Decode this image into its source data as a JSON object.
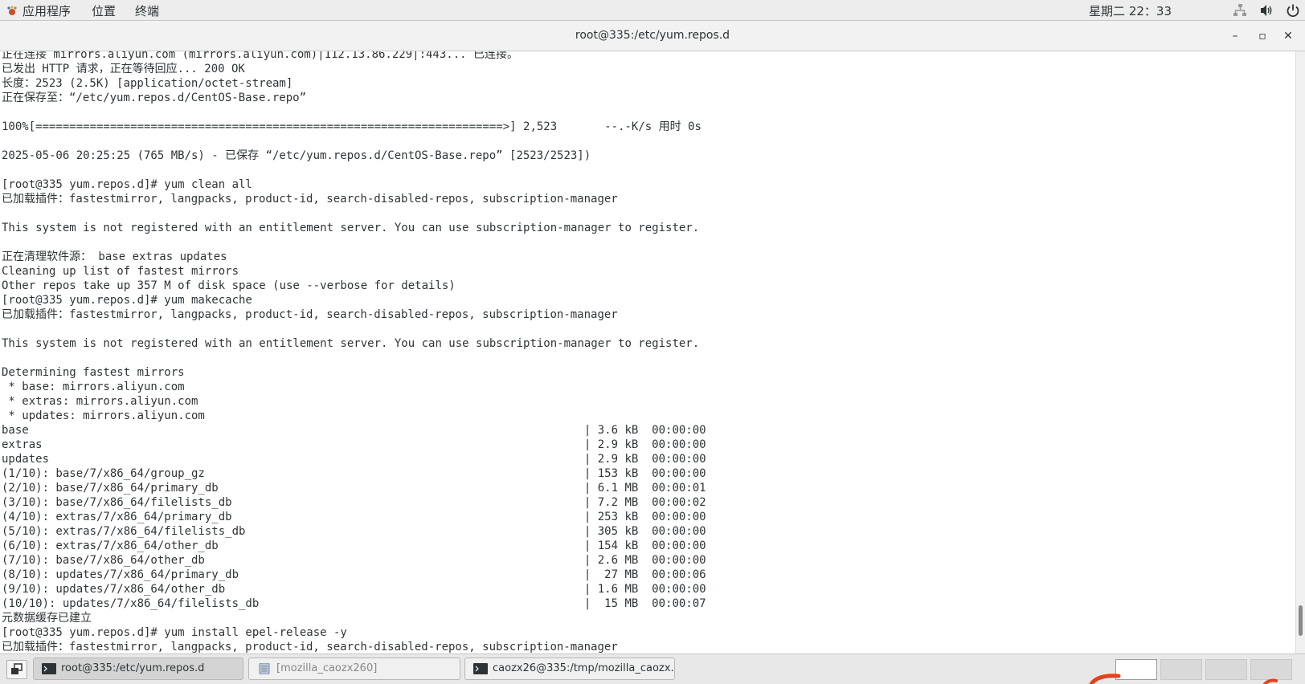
{
  "topbar": {
    "menu_app": "应用程序",
    "menu_places": "位置",
    "menu_terminal": "终端",
    "clock": "星期二 22：33",
    "icons": [
      "network-icon",
      "volume-icon",
      "power-icon"
    ]
  },
  "window": {
    "title": "root@335:/etc/yum.repos.d",
    "controls": {
      "minimize": "–",
      "maximize": "▫",
      "close": "✕"
    }
  },
  "terminal": {
    "lines": [
      "正在连接 mirrors.aliyun.com (mirrors.aliyun.com)|112.13.86.229|:443... 已连接。",
      "已发出 HTTP 请求，正在等待回应... 200 OK",
      "长度：2523 (2.5K) [application/octet-stream]",
      "正在保存至：“/etc/yum.repos.d/CentOS-Base.repo”",
      "",
      "100%[=====================================================================>] 2,523       --.-K/s 用时 0s",
      "",
      "2025-05-06 20:25:25 (765 MB/s) - 已保存 “/etc/yum.repos.d/CentOS-Base.repo” [2523/2523])",
      "",
      "[root@335 yum.repos.d]# yum clean all",
      "已加载插件：fastestmirror, langpacks, product-id, search-disabled-repos, subscription-manager",
      "",
      "This system is not registered with an entitlement server. You can use subscription-manager to register.",
      "",
      "正在清理软件源： base extras updates",
      "Cleaning up list of fastest mirrors",
      "Other repos take up 357 M of disk space (use --verbose for details)",
      "[root@335 yum.repos.d]# yum makecache",
      "已加载插件：fastestmirror, langpacks, product-id, search-disabled-repos, subscription-manager",
      "",
      "This system is not registered with an entitlement server. You can use subscription-manager to register.",
      "",
      "Determining fastest mirrors",
      " * base: mirrors.aliyun.com",
      " * extras: mirrors.aliyun.com",
      " * updates: mirrors.aliyun.com",
      "base                                                                                  | 3.6 kB  00:00:00",
      "extras                                                                                | 2.9 kB  00:00:00",
      "updates                                                                               | 2.9 kB  00:00:00",
      "(1/10): base/7/x86_64/group_gz                                                        | 153 kB  00:00:00",
      "(2/10): base/7/x86_64/primary_db                                                      | 6.1 MB  00:00:01",
      "(3/10): base/7/x86_64/filelists_db                                                    | 7.2 MB  00:00:02",
      "(4/10): extras/7/x86_64/primary_db                                                    | 253 kB  00:00:00",
      "(5/10): extras/7/x86_64/filelists_db                                                  | 305 kB  00:00:00",
      "(6/10): extras/7/x86_64/other_db                                                      | 154 kB  00:00:00",
      "(7/10): base/7/x86_64/other_db                                                        | 2.6 MB  00:00:00",
      "(8/10): updates/7/x86_64/primary_db                                                   |  27 MB  00:00:06",
      "(9/10): updates/7/x86_64/other_db                                                     | 1.6 MB  00:00:00",
      "(10/10): updates/7/x86_64/filelists_db                                                |  15 MB  00:00:07",
      "元数据缓存已建立",
      "[root@335 yum.repos.d]# yum install epel-release -y",
      "已加载插件：fastestmirror, langpacks, product-id, search-disabled-repos, subscription-manager"
    ]
  },
  "taskbar": {
    "tasks": [
      {
        "label": "root@335:/etc/yum.repos.d",
        "icon": "terminal-icon",
        "active": true
      },
      {
        "label": "[mozilla_caozx260]",
        "icon": "file-manager-icon",
        "active": false
      },
      {
        "label": "caozx26@335:/tmp/mozilla_caozx…",
        "icon": "terminal-icon",
        "active": false
      }
    ],
    "workspaces": [
      1,
      2,
      3,
      4
    ],
    "active_workspace": 1
  }
}
